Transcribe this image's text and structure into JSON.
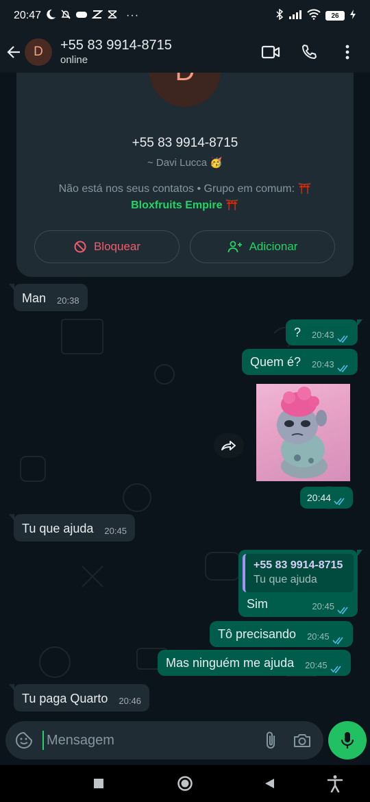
{
  "status_bar": {
    "time": "20:47",
    "battery": "26"
  },
  "header": {
    "avatar_letter": "D",
    "title": "+55 83 9914-8715",
    "subtitle": "online"
  },
  "profile_card": {
    "avatar_letter": "D",
    "phone": "+55 83 9914-8715",
    "push_name": "~ Davi Lucca 🥳",
    "info_text": "Não está nos seus contatos • Grupo em comum: ⛩️",
    "group_name": "Bloxfruits Empire ⛩️",
    "block_label": "Bloquear",
    "add_label": "Adicionar"
  },
  "messages": [
    {
      "dir": "in",
      "text": "Man",
      "time": "20:38"
    },
    {
      "dir": "out",
      "text": "?",
      "time": "20:43"
    },
    {
      "dir": "out",
      "text": "Quem é?",
      "time": "20:43"
    },
    {
      "dir": "out",
      "type": "sticker",
      "time": "20:44"
    },
    {
      "dir": "in",
      "text": "Tu que ajuda",
      "time": "20:45"
    },
    {
      "dir": "out",
      "text": "Sim",
      "time": "20:45",
      "reply_to": {
        "name": "+55 83 9914-8715",
        "text": "Tu que ajuda"
      }
    },
    {
      "dir": "out",
      "text": "Tô precisando",
      "time": "20:45"
    },
    {
      "dir": "out",
      "text": "Mas ninguém me ajuda",
      "time": "20:45"
    },
    {
      "dir": "in",
      "text": "Tu paga Quarto",
      "time": "20:46"
    }
  ],
  "input": {
    "placeholder": "Mensagem"
  },
  "colors": {
    "background": "#0b141a",
    "incoming_bubble": "#1f2c33",
    "outgoing_bubble": "#005c4b",
    "accent": "#25d366",
    "read_ticks": "#53bdeb",
    "block_red": "#f15c6d"
  },
  "icons": [
    "back-arrow-icon",
    "video-call-icon",
    "phone-icon",
    "more-vertical-icon",
    "block-icon",
    "add-person-icon",
    "forward-icon",
    "sticker-icon",
    "attach-icon",
    "camera-icon",
    "mic-icon"
  ]
}
